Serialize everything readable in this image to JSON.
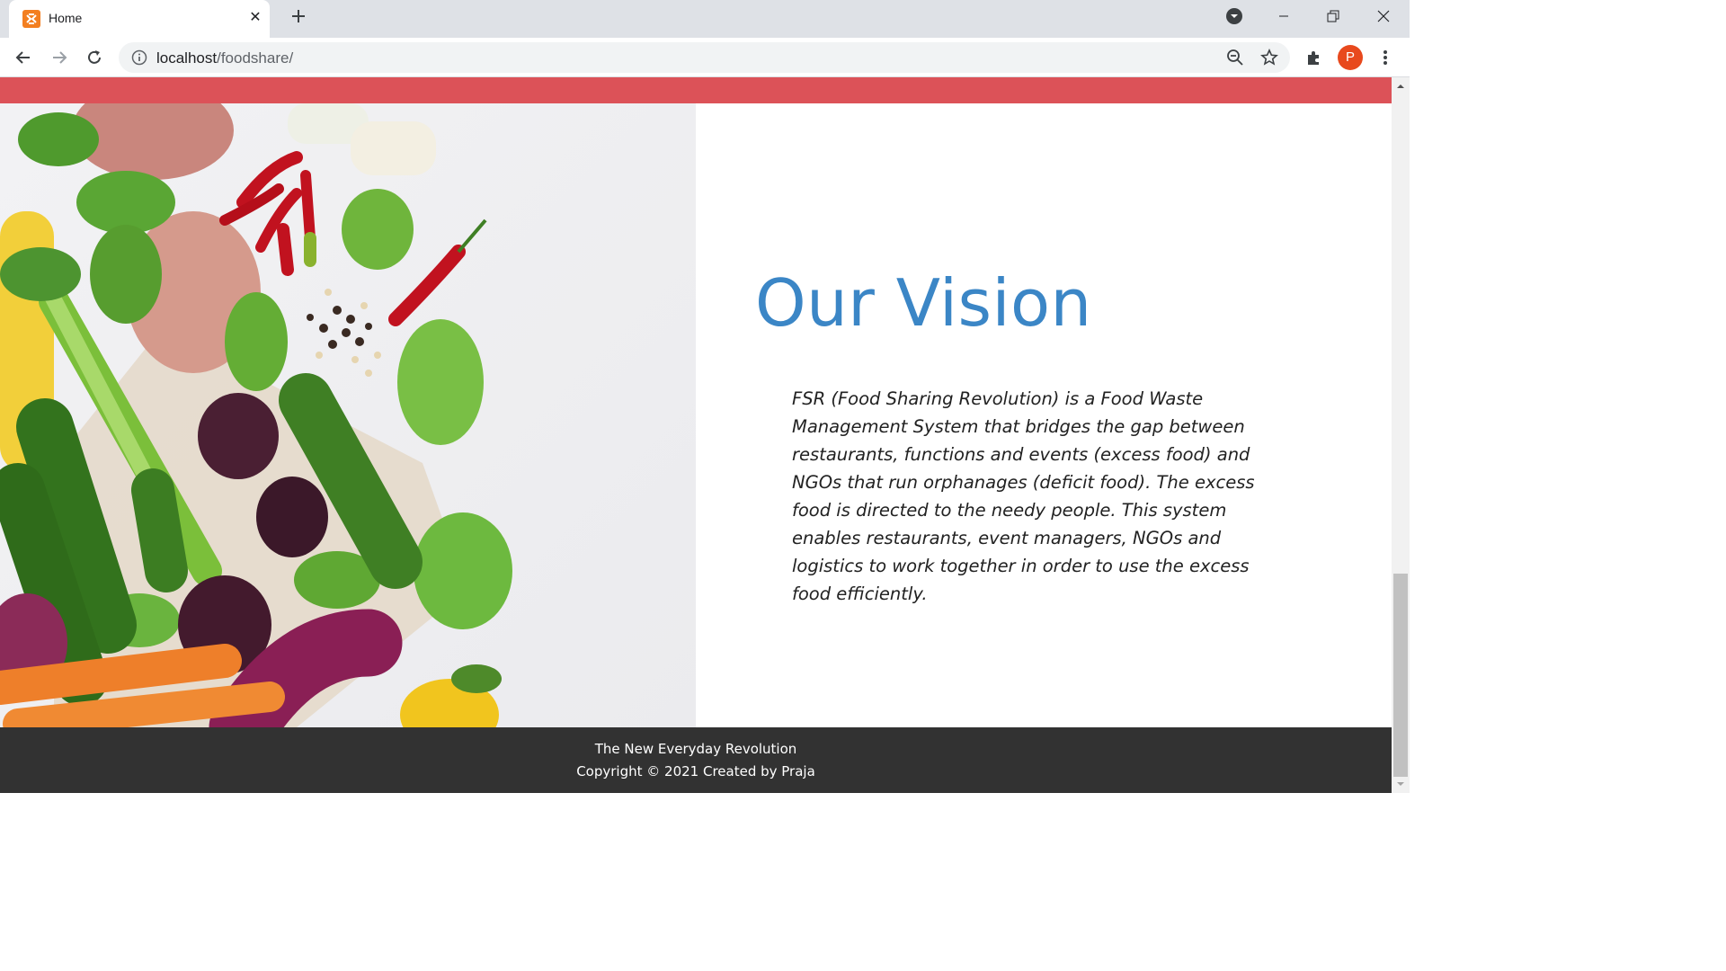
{
  "browser": {
    "tab_title": "Home",
    "url_host": "localhost",
    "url_path": "/foodshare/",
    "profile_initial": "P",
    "profile_color": "#e8491d"
  },
  "page": {
    "accent_band_color": "#dc5258",
    "vision": {
      "title": "Our Vision",
      "body": "FSR (Food Sharing Revolution) is a Food Waste Management System that bridges the gap between restaurants, functions and events (excess food) and NGOs that run orphanages (deficit food). The excess food is directed to the needy people. This system enables restaurants, event managers, NGOs and logistics to work together in order to use the excess food efficiently.",
      "title_color": "#3b86c6"
    },
    "footer": {
      "line1": "The New Everyday Revolution",
      "line2": "Copyright © 2021 Created by Praja"
    }
  }
}
